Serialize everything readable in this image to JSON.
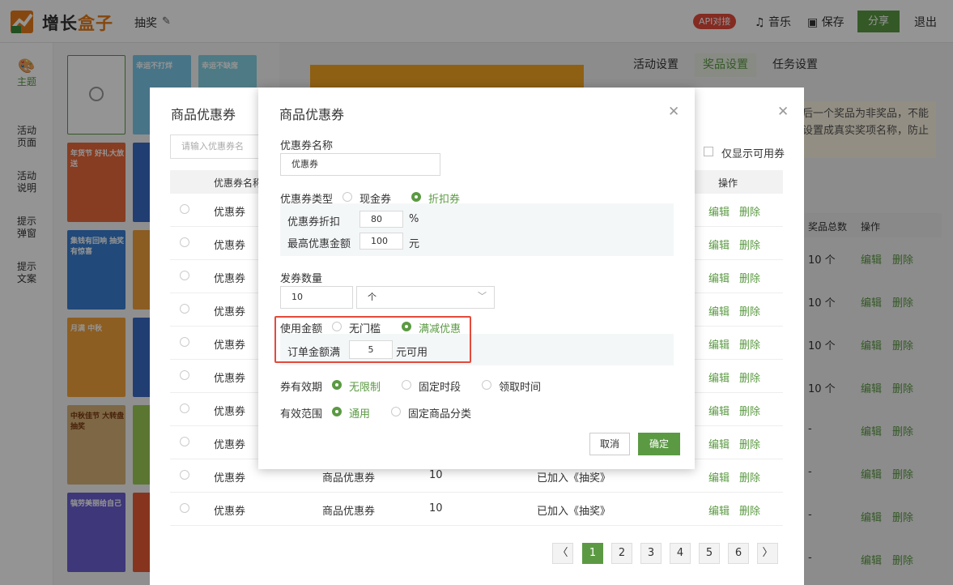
{
  "header": {
    "brand_a": "增长",
    "brand_b": "盒子",
    "page_name": "抽奖",
    "api_badge": "API对接",
    "music": "音乐",
    "save": "保存",
    "share": "分享",
    "logout": "退出"
  },
  "sidebar": {
    "items": [
      {
        "label": "主题"
      },
      {
        "label": "活动\n页面"
      },
      {
        "label": "活动\n说明"
      },
      {
        "label": "提示\n弹窗"
      },
      {
        "label": "提示\n文案"
      }
    ]
  },
  "thumbnails": {
    "t1": "幸运不打烊",
    "t2": "幸运不缺席",
    "t3": "年货节 好礼大放送",
    "t4": "集钱有回响 抽奖有惊喜",
    "t5": "月满 中秋",
    "t6": "中秋佳节 大转盘抽奖",
    "t7": "犒劳美丽给自己"
  },
  "settings_tabs": [
    "活动设置",
    "奖品设置",
    "任务设置"
  ],
  "notice": {
    "line1": "后一个奖品为非奖品，不能",
    "line2": "设置成真实奖项名称，防止"
  },
  "prize_table": {
    "col_total": "奖品总数",
    "col_ops": "操作",
    "edit": "编辑",
    "delete": "删除",
    "rows": [
      "10 个",
      "10 个",
      "10 个",
      "10 个",
      "-",
      "-",
      "-",
      "-",
      "-"
    ]
  },
  "coupon_list": {
    "title": "商品优惠券",
    "search_placeholder": "请输入优惠券名",
    "only_available": "仅显示可用券",
    "col_name": "优惠券名称",
    "col_ops": "操作",
    "edit": "编辑",
    "delete": "删除",
    "rows": [
      {
        "name": "优惠券",
        "type": "",
        "qty": "",
        "status": ""
      },
      {
        "name": "优惠券",
        "type": "",
        "qty": "",
        "status": ""
      },
      {
        "name": "优惠券",
        "type": "",
        "qty": "",
        "status": ""
      },
      {
        "name": "优惠券",
        "type": "",
        "qty": "",
        "status": ""
      },
      {
        "name": "优惠券",
        "type": "",
        "qty": "",
        "status": ""
      },
      {
        "name": "优惠券",
        "type": "",
        "qty": "",
        "status": ""
      },
      {
        "name": "优惠券",
        "type": "",
        "qty": "",
        "status": ""
      },
      {
        "name": "优惠券",
        "type": "",
        "qty": "",
        "status": ""
      },
      {
        "name": "优惠券",
        "type": "商品优惠券",
        "qty": "10",
        "status": "已加入《抽奖》"
      },
      {
        "name": "优惠券",
        "type": "商品优惠券",
        "qty": "10",
        "status": "已加入《抽奖》"
      }
    ],
    "pages": [
      "1",
      "2",
      "3",
      "4",
      "5",
      "6"
    ],
    "prev": "〈",
    "next": "〉"
  },
  "dialog": {
    "title": "商品优惠券",
    "name_label": "优惠券名称",
    "name_value": "优惠券",
    "type_label": "优惠券类型",
    "type_cash": "现金券",
    "type_discount": "折扣券",
    "discount_label": "优惠券折扣",
    "discount_value": "80",
    "discount_unit": "%",
    "max_label": "最高优惠金额",
    "max_value": "100",
    "max_unit": "元",
    "qty_label": "发券数量",
    "qty_value": "10",
    "qty_unit": "个",
    "amount_label": "使用金额",
    "amount_none": "无门槛",
    "amount_full": "满减优惠",
    "order_label": "订单金额满",
    "order_value": "5",
    "order_unit": "元可用",
    "validity_label": "券有效期",
    "validity_unlimited": "无限制",
    "validity_fixed": "固定时段",
    "validity_claim": "领取时间",
    "scope_label": "有效范围",
    "scope_all": "通用",
    "scope_category": "固定商品分类",
    "cancel": "取消",
    "confirm": "确定"
  },
  "colors": {
    "accent": "#5b9a43",
    "badge": "#e44a3b",
    "highlight_border": "#e44a3b"
  }
}
